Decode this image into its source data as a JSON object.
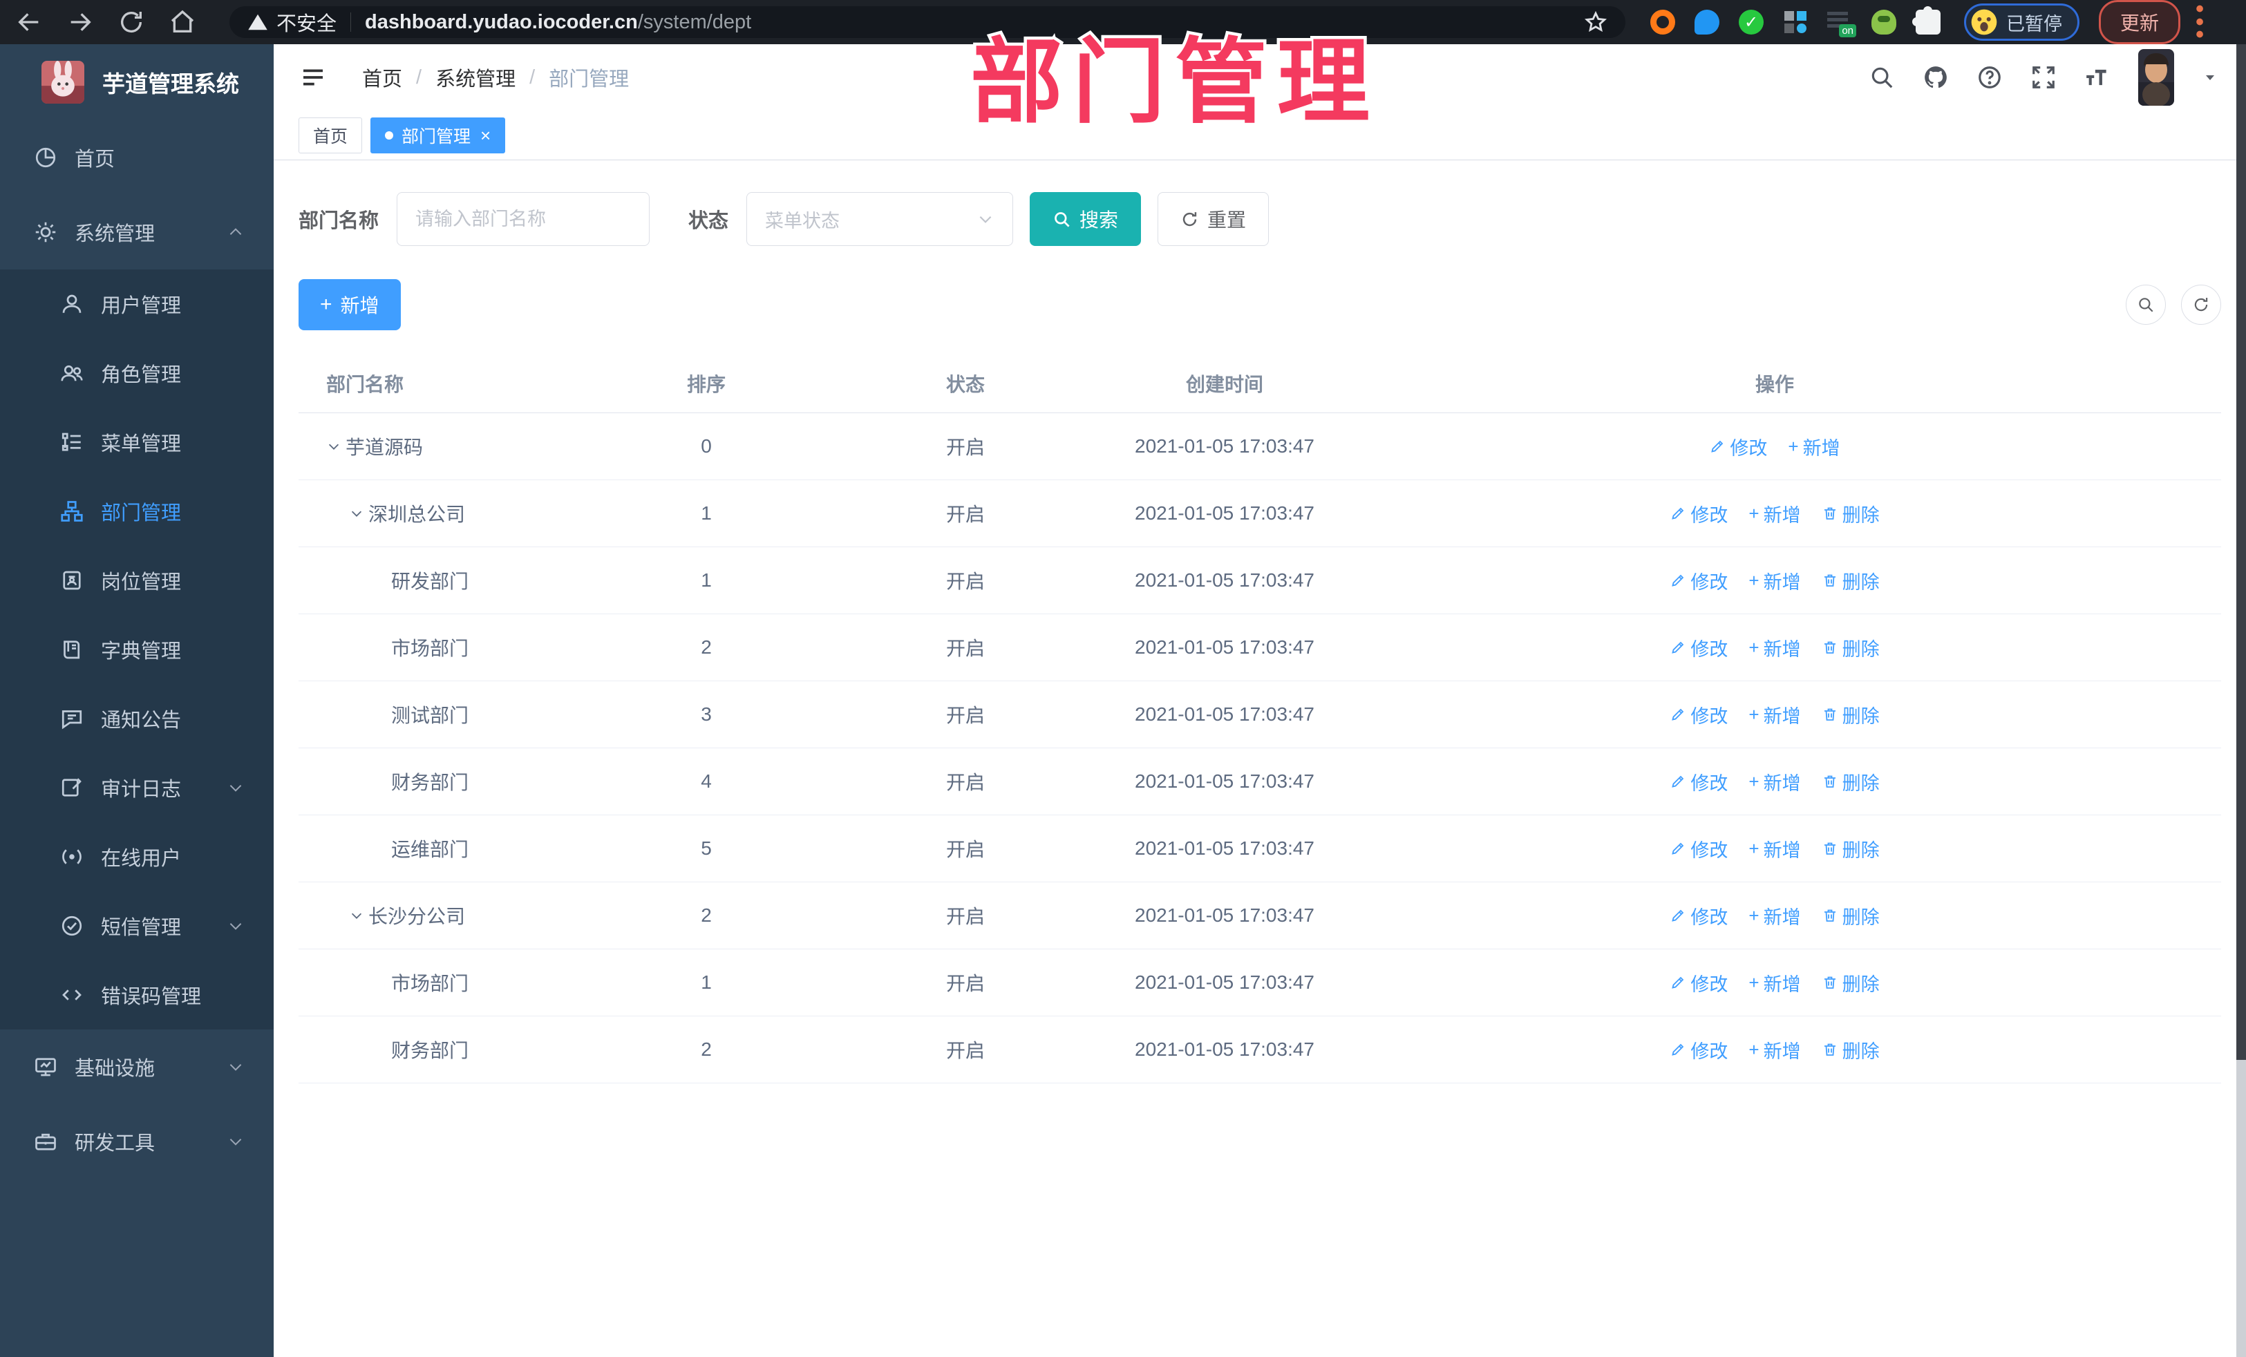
{
  "browser": {
    "security_label": "不安全",
    "url_domain": "dashboard.yudao.iocoder.cn",
    "url_path": "/system/dept",
    "paused_label": "已暂停",
    "update_label": "更新",
    "extensions": [
      "orange-ring-extension-icon",
      "blue-pin-extension-icon",
      "green-check-extension-icon",
      "grid-extension-icon",
      "on-badge-extension-icon",
      "spy-extension-icon",
      "puzzle-extension-icon"
    ]
  },
  "watermark": "部门管理",
  "colors": {
    "accent": "#409eff",
    "search_teal": "#1ab2b0",
    "annotation_pink": "#f43a5f",
    "sidebar_bg": "#2d4357",
    "submenu_bg": "#24384a"
  },
  "sidebar": {
    "title": "芋道管理系统",
    "menu": [
      {
        "label": "首页",
        "icon": "dashboard-icon",
        "level": 0
      },
      {
        "label": "系统管理",
        "icon": "gear-icon",
        "level": 0,
        "chevron": "up"
      },
      {
        "label": "用户管理",
        "icon": "user-icon",
        "level": 1
      },
      {
        "label": "角色管理",
        "icon": "users-icon",
        "level": 1
      },
      {
        "label": "菜单管理",
        "icon": "menu-list-icon",
        "level": 1
      },
      {
        "label": "部门管理",
        "icon": "org-icon",
        "level": 1,
        "active": true
      },
      {
        "label": "岗位管理",
        "icon": "badge-icon",
        "level": 1
      },
      {
        "label": "字典管理",
        "icon": "book-icon",
        "level": 1
      },
      {
        "label": "通知公告",
        "icon": "megaphone-icon",
        "level": 1
      },
      {
        "label": "审计日志",
        "icon": "log-icon",
        "level": 1,
        "chevron": "down"
      },
      {
        "label": "在线用户",
        "icon": "online-icon",
        "level": 1
      },
      {
        "label": "短信管理",
        "icon": "sms-icon",
        "level": 1,
        "chevron": "down"
      },
      {
        "label": "错误码管理",
        "icon": "code-icon",
        "level": 1
      },
      {
        "label": "基础设施",
        "icon": "infra-icon",
        "level": 0,
        "chevron": "down"
      },
      {
        "label": "研发工具",
        "icon": "tools-icon",
        "level": 0,
        "chevron": "down"
      }
    ]
  },
  "header": {
    "breadcrumb": [
      "首页",
      "系统管理",
      "部门管理"
    ]
  },
  "tabs": [
    {
      "label": "首页",
      "active": false,
      "closable": false
    },
    {
      "label": "部门管理",
      "active": true,
      "closable": true
    }
  ],
  "filter": {
    "name_label": "部门名称",
    "name_placeholder": "请输入部门名称",
    "status_label": "状态",
    "status_placeholder": "菜单状态",
    "search_label": "搜索",
    "reset_label": "重置"
  },
  "toolbar": {
    "add_label": "新增"
  },
  "table": {
    "columns": [
      "部门名称",
      "排序",
      "状态",
      "创建时间",
      "操作"
    ],
    "action_labels": {
      "edit": "修改",
      "add": "新增",
      "delete": "删除"
    },
    "rows": [
      {
        "name": "芋道源码",
        "level": 0,
        "expandable": true,
        "sort": "0",
        "status": "开启",
        "time": "2021-01-05 17:03:47",
        "actions": [
          "edit",
          "add"
        ]
      },
      {
        "name": "深圳总公司",
        "level": 1,
        "expandable": true,
        "sort": "1",
        "status": "开启",
        "time": "2021-01-05 17:03:47",
        "actions": [
          "edit",
          "add",
          "delete"
        ]
      },
      {
        "name": "研发部门",
        "level": 2,
        "expandable": false,
        "sort": "1",
        "status": "开启",
        "time": "2021-01-05 17:03:47",
        "actions": [
          "edit",
          "add",
          "delete"
        ]
      },
      {
        "name": "市场部门",
        "level": 2,
        "expandable": false,
        "sort": "2",
        "status": "开启",
        "time": "2021-01-05 17:03:47",
        "actions": [
          "edit",
          "add",
          "delete"
        ]
      },
      {
        "name": "测试部门",
        "level": 2,
        "expandable": false,
        "sort": "3",
        "status": "开启",
        "time": "2021-01-05 17:03:47",
        "actions": [
          "edit",
          "add",
          "delete"
        ]
      },
      {
        "name": "财务部门",
        "level": 2,
        "expandable": false,
        "sort": "4",
        "status": "开启",
        "time": "2021-01-05 17:03:47",
        "actions": [
          "edit",
          "add",
          "delete"
        ]
      },
      {
        "name": "运维部门",
        "level": 2,
        "expandable": false,
        "sort": "5",
        "status": "开启",
        "time": "2021-01-05 17:03:47",
        "actions": [
          "edit",
          "add",
          "delete"
        ]
      },
      {
        "name": "长沙分公司",
        "level": 1,
        "expandable": true,
        "sort": "2",
        "status": "开启",
        "time": "2021-01-05 17:03:47",
        "actions": [
          "edit",
          "add",
          "delete"
        ]
      },
      {
        "name": "市场部门",
        "level": 2,
        "expandable": false,
        "sort": "1",
        "status": "开启",
        "time": "2021-01-05 17:03:47",
        "actions": [
          "edit",
          "add",
          "delete"
        ]
      },
      {
        "name": "财务部门",
        "level": 2,
        "expandable": false,
        "sort": "2",
        "status": "开启",
        "time": "2021-01-05 17:03:47",
        "actions": [
          "edit",
          "add",
          "delete"
        ]
      }
    ]
  }
}
